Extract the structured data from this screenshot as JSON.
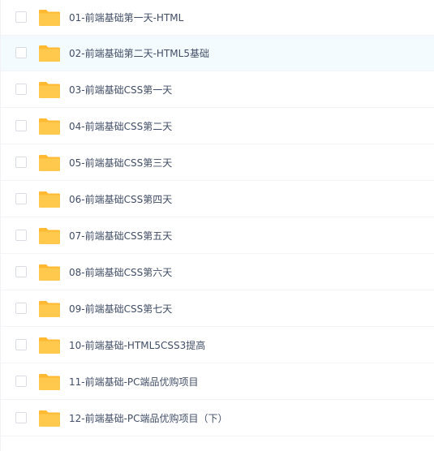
{
  "colors": {
    "folder_body": "#ffc94d",
    "folder_tab": "#ffb933",
    "text": "#424e67",
    "row_hover_bg": "#f4fbff",
    "divider": "#f2f4f8",
    "checkbox_border": "#d9dde3"
  },
  "file_list": {
    "icon": "folder-icon",
    "items": [
      {
        "name": "01-前端基础第一天-HTML",
        "checked": false
      },
      {
        "name": "02-前端基础第二天-HTML5基础",
        "checked": false,
        "hovered": true
      },
      {
        "name": "03-前端基础CSS第一天",
        "checked": false
      },
      {
        "name": "04-前端基础CSS第二天",
        "checked": false
      },
      {
        "name": "05-前端基础CSS第三天",
        "checked": false
      },
      {
        "name": "06-前端基础CSS第四天",
        "checked": false
      },
      {
        "name": "07-前端基础CSS第五天",
        "checked": false
      },
      {
        "name": "08-前端基础CSS第六天",
        "checked": false
      },
      {
        "name": "09-前端基础CSS第七天",
        "checked": false
      },
      {
        "name": "10-前端基础-HTML5CSS3提高",
        "checked": false
      },
      {
        "name": "11-前端基础-PC端品优购项目",
        "checked": false
      },
      {
        "name": "12-前端基础-PC端品优购项目（下）",
        "checked": false
      }
    ]
  }
}
